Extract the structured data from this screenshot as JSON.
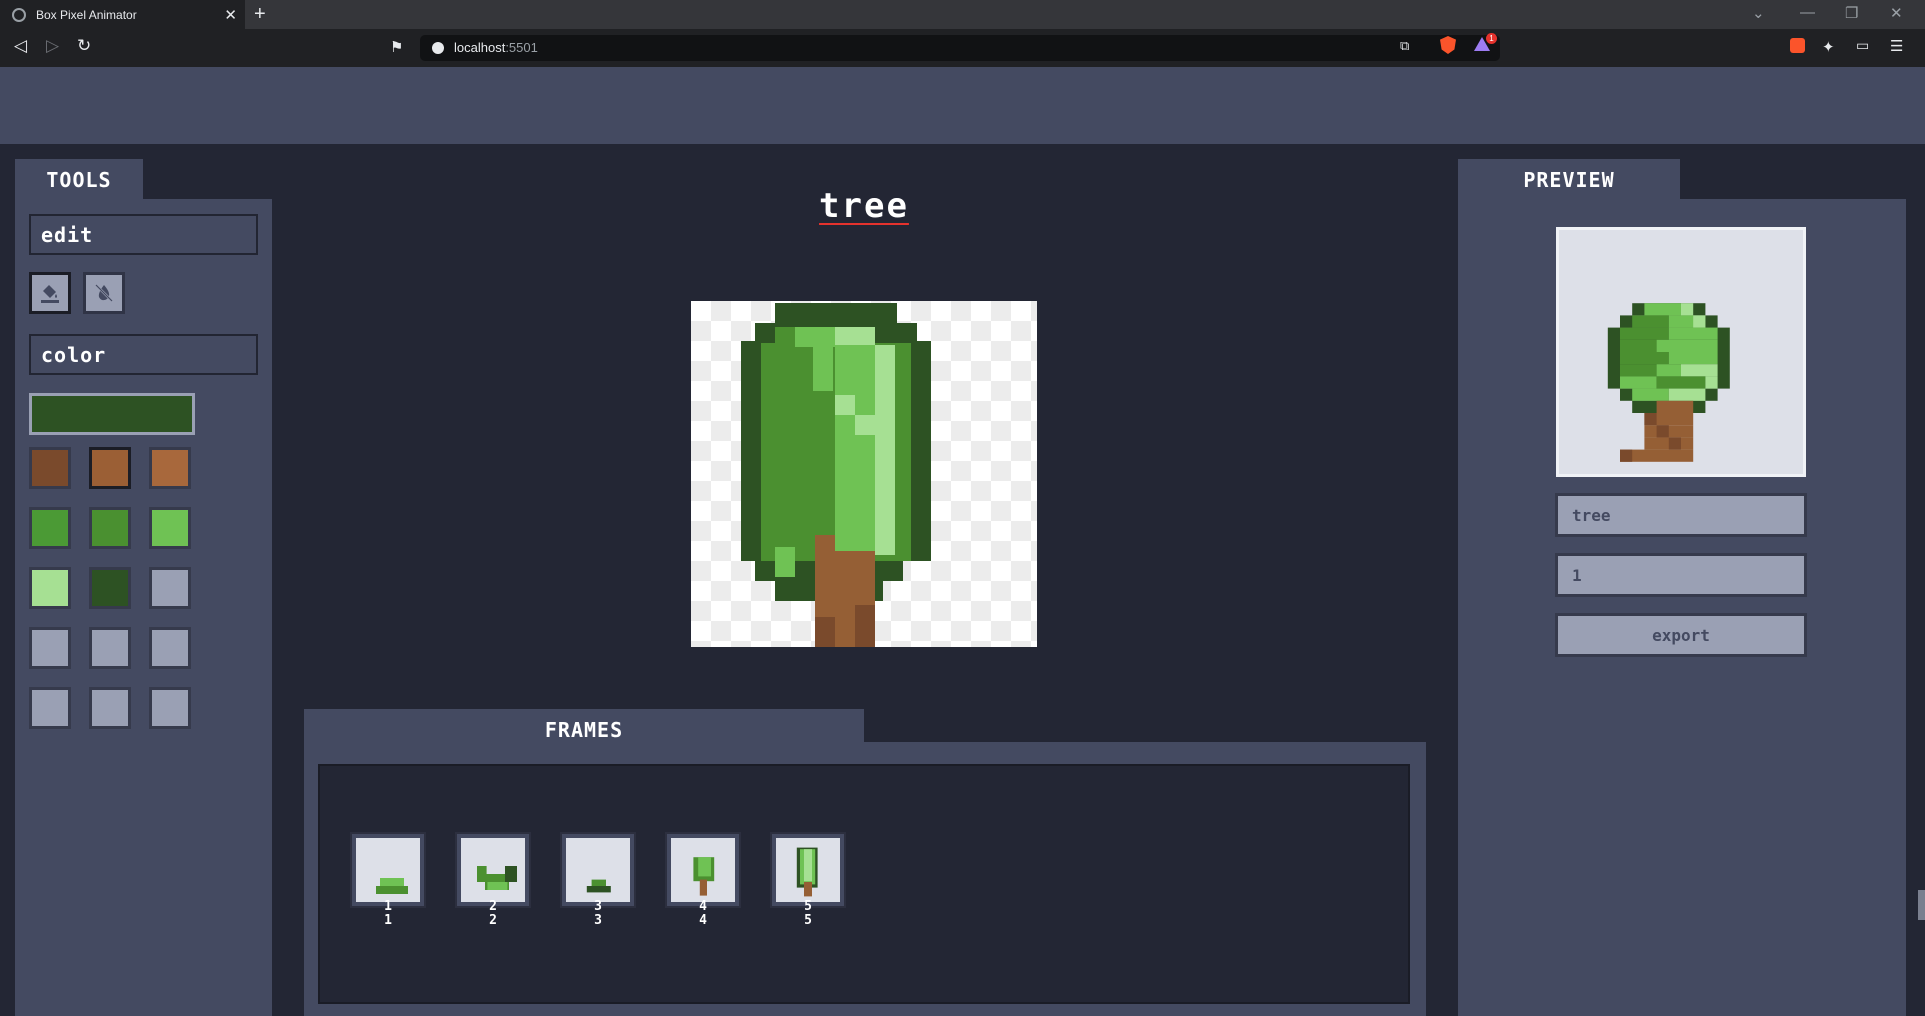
{
  "browser": {
    "tab_title": "Box Pixel Animator",
    "url_host": "localhost",
    "url_port": ":5501",
    "badge_count": "1"
  },
  "tools": {
    "tab_label": "TOOLS",
    "edit_label": "edit",
    "color_label": "color",
    "current_color": "#2d5223",
    "swatches": [
      "#7a4a2c",
      "#9b5f35",
      "#a8683c",
      "#4b9a35",
      "#4a9030",
      "#6fc254",
      "#a6e093",
      "#2d5223",
      "#9aa0b4",
      "#9aa0b4",
      "#9aa0b4",
      "#9aa0b4",
      "#9aa0b4",
      "#9aa0b4",
      "#9aa0b4"
    ],
    "buttons": [
      "fill-bucket",
      "no-fill"
    ]
  },
  "canvas": {
    "title": "tree"
  },
  "frames": {
    "tab_label": "FRAMES",
    "items": [
      {
        "number": "1",
        "index": "1"
      },
      {
        "number": "2",
        "index": "2"
      },
      {
        "number": "3",
        "index": "3"
      },
      {
        "number": "4",
        "index": "4"
      },
      {
        "number": "5",
        "index": "5"
      }
    ]
  },
  "preview": {
    "tab_label": "PREVIEW",
    "name_value": "tree",
    "speed_value": "1",
    "export_label": "export"
  }
}
